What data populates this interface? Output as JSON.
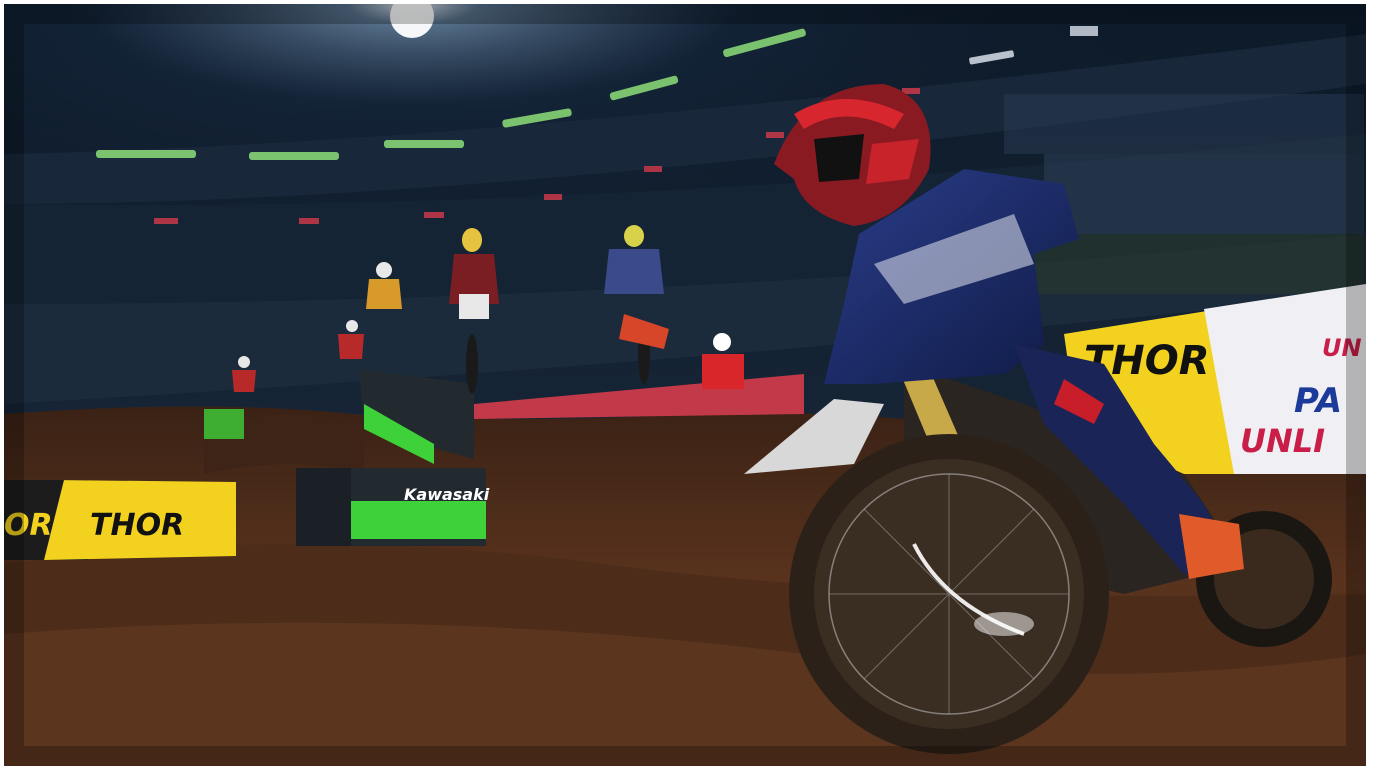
{
  "scene": {
    "type": "supercross-gameplay-screenshot",
    "description_hidden": true,
    "colors": {
      "sky": "#0b1726",
      "stands": "#1a2a3d",
      "dirt": "#4a2b1a",
      "dirt_light": "#7a4a2a",
      "thor_yellow": "#f2d21e",
      "kawasaki_green": "#3fd13a",
      "rider_blue": "#1c2a6b",
      "rider_red": "#c81e2a"
    }
  },
  "signage": {
    "thor_left_1": "OR",
    "thor_left_2": "THOR",
    "thor_right": "THOR",
    "kawasaki": "Kawasaki",
    "parts_unlimited_1": "PA",
    "parts_unlimited_2": "UNLI",
    "parts_unlimited_top": "UN"
  }
}
